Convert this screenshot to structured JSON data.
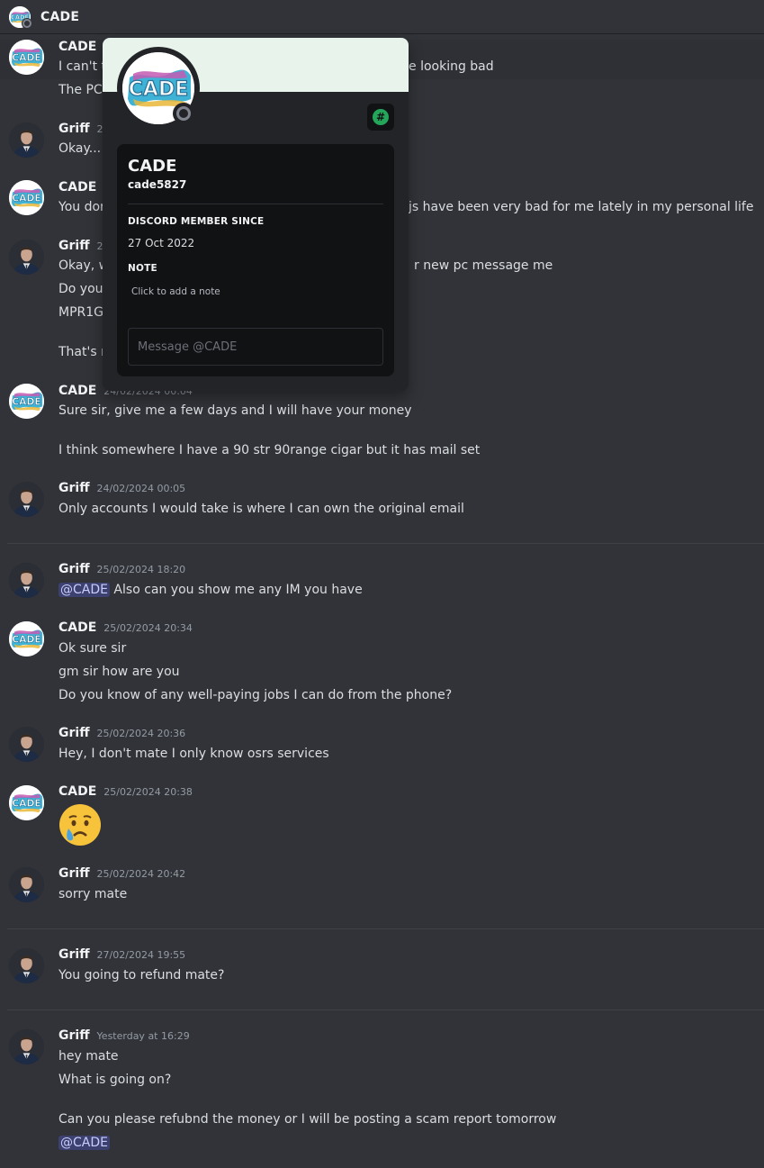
{
  "header": {
    "title": "CADE"
  },
  "popup": {
    "display_name": "CADE",
    "username": "cade5827",
    "member_since_label": "DISCORD MEMBER SINCE",
    "member_since": "27 Oct 2022",
    "note_label": "NOTE",
    "note_placeholder": "Click to add a note",
    "message_placeholder": "Message @CADE",
    "avatar_text": "CADE",
    "banner_color": "#e8f3ec",
    "badge_icon": "hash-badge-icon"
  },
  "messages": {
    "m1": {
      "author": "CADE",
      "l1_a": "I can't t",
      "l1_b": "e looking bad",
      "l2": "The PC"
    },
    "m2": {
      "author": "Griff",
      "ts": "24",
      "l1": "Okay..."
    },
    "m3": {
      "author": "CADE",
      "l1_a": "You dor",
      "l1_b": "js have been very bad for me lately in my personal life"
    },
    "m4": {
      "author": "Griff",
      "ts": "24",
      "l1_a": "Okay, w",
      "l1_b": "r new pc message me",
      "l2": "Do you",
      "l3": "MPR1G",
      "l4": "That's r"
    },
    "m5": {
      "author": "CADE",
      "ts": "24/02/2024 00:04",
      "l1": "Sure sir, give me a few days and I will have your money",
      "l2": "I think somewhere I have a 90 str 90range cigar but it has mail set"
    },
    "m6": {
      "author": "Griff",
      "ts": "24/02/2024 00:05",
      "l1": "Only accounts I would take is where I can own the original email"
    },
    "m7": {
      "author": "Griff",
      "ts": "25/02/2024 18:20",
      "mention": "@CADE",
      "l1": " Also can you show me any IM you have"
    },
    "m8": {
      "author": "CADE",
      "ts": "25/02/2024 20:34",
      "l1": "Ok sure sir",
      "l2": "gm sir how are you",
      "l3": "Do you know of any well-paying jobs I can do from the phone?"
    },
    "m9": {
      "author": "Griff",
      "ts": "25/02/2024 20:36",
      "l1": "Hey, I don't mate I only know osrs services"
    },
    "m10": {
      "author": "CADE",
      "ts": "25/02/2024 20:38",
      "emoji": "crying-face-emoji"
    },
    "m11": {
      "author": "Griff",
      "ts": "25/02/2024 20:42",
      "l1": "sorry mate"
    },
    "m12": {
      "author": "Griff",
      "ts": "27/02/2024 19:55",
      "l1": "You going to refund mate?"
    },
    "m13": {
      "author": "Griff",
      "ts": "Yesterday at 16:29",
      "l1": "hey mate",
      "l2": "What is going on?",
      "l3": "Can you please refubnd the money or I will be posting a scam report tomorrow",
      "mention": "@CADE"
    }
  },
  "colors": {
    "background": "#313338",
    "mention_bg": "#3c4270",
    "online_badge": "#23a55a",
    "offline_status": "#80848e"
  }
}
